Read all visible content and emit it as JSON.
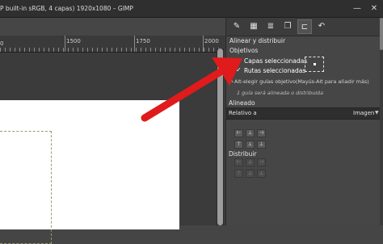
{
  "window": {
    "title": "P built-in sRGB, 4 capas) 1920x1080 – GIMP",
    "minimize_glyph": "—",
    "close_glyph": "✕"
  },
  "ruler": {
    "labels": [
      "1500",
      "1750",
      "2000"
    ],
    "edge_label": "0"
  },
  "panel": {
    "tabs": [
      {
        "icon": "paintbrush-icon",
        "glyph": "✎"
      },
      {
        "icon": "grid-icon",
        "glyph": "▦"
      },
      {
        "icon": "layers-stack-icon",
        "glyph": "≣"
      },
      {
        "icon": "copy-icon",
        "glyph": "❐"
      },
      {
        "icon": "align-tool-icon",
        "glyph": "⊏"
      },
      {
        "icon": "undo-icon",
        "glyph": "↶"
      }
    ],
    "title": "Alinear y distribuir",
    "objetivos_label": "Objetivos",
    "capas_label": "Capas seleccionadas",
    "capas_checked": false,
    "rutas_label": "Rutas seleccionadas",
    "rutas_checked": true,
    "hint": "Alt-elegir guías objetivo(Mayús-Alt para añadir más)",
    "note": "1 guía será alineada o distribuida",
    "alineado_label": "Alineado",
    "relativo_label": "Relativo a",
    "relativo_value": "Imagen",
    "distribuir_label": "Distribuir",
    "check_glyph": "✓",
    "cursor_glyph": "↖"
  },
  "colors": {
    "arrow": "#e01b1b",
    "panel_bg": "#464646",
    "canvas_bg": "#3b3b3b"
  }
}
